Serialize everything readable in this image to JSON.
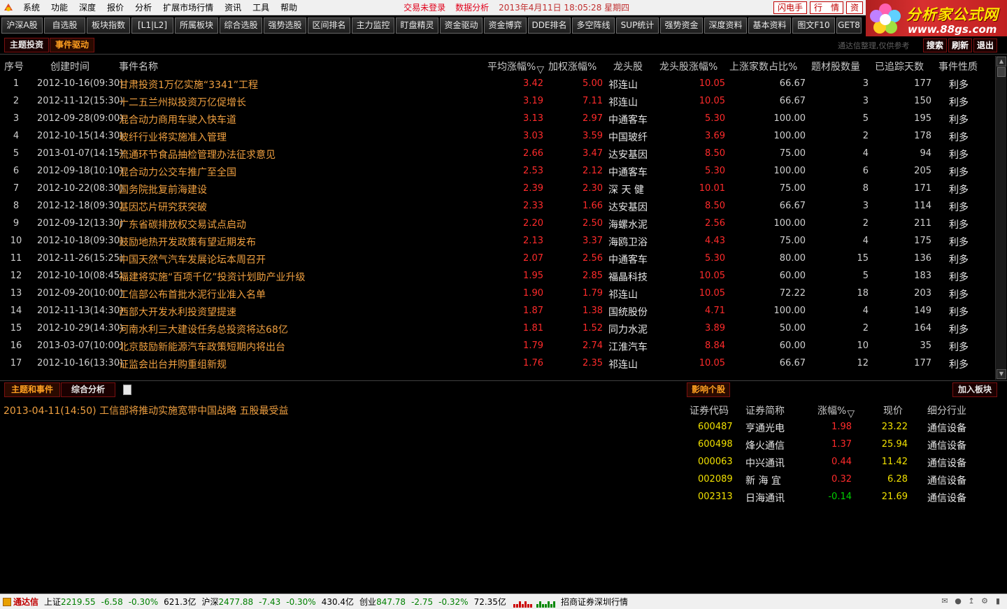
{
  "menu": {
    "items": [
      "系统",
      "功能",
      "深度",
      "报价",
      "分析",
      "扩展市场行情",
      "资讯",
      "工具",
      "帮助"
    ],
    "status_login": "交易未登录",
    "status_analysis": "数据分析",
    "datetime": "2013年4月11日  18:05:28  星期四",
    "btn_flash": "闪电手",
    "btn_quote": "行　情",
    "btn_info": "资"
  },
  "brand": {
    "title": "分析家公式网",
    "url": "www.88gs.com"
  },
  "toolbar": {
    "buttons": [
      "沪深A股",
      "自选股",
      "板块指数",
      "[L1|L2]",
      "所属板块",
      "综合选股",
      "强势选股",
      "区间排名",
      "主力监控",
      "盯盘精灵",
      "资金驱动",
      "资金博弈",
      "DDE排名",
      "多空阵线",
      "SUP统计",
      "强势资金",
      "深度资料",
      "基本资料",
      "图文F10",
      "GET8"
    ]
  },
  "subheader": {
    "tab_theme": "主题投资",
    "tab_event": "事件驱动",
    "hint": "通达信整理,仅供参考",
    "btn_search": "搜索",
    "btn_refresh": "刷新",
    "btn_exit": "退出"
  },
  "table": {
    "headers": {
      "idx": "序号",
      "time": "创建时间",
      "name": "事件名称",
      "avg": "平均涨幅%",
      "wavg": "加权涨幅%",
      "lead": "龙头股",
      "leadpct": "龙头股涨幅%",
      "up": "上涨家数占比%",
      "cnt": "题材股数量",
      "days": "已追踪天数",
      "type": "事件性质"
    },
    "rows": [
      {
        "idx": "1",
        "time": "2012-10-16(09:30)",
        "name": "甘肃投资1万亿实施“3341”工程",
        "avg": "3.42",
        "wavg": "5.00",
        "lead": "祁连山",
        "leadpct": "10.05",
        "up": "66.67",
        "cnt": "3",
        "days": "177",
        "type": "利多"
      },
      {
        "idx": "2",
        "time": "2012-11-12(15:30)",
        "name": "十二五兰州拟投资万亿促增长",
        "avg": "3.19",
        "wavg": "7.11",
        "lead": "祁连山",
        "leadpct": "10.05",
        "up": "66.67",
        "cnt": "3",
        "days": "150",
        "type": "利多"
      },
      {
        "idx": "3",
        "time": "2012-09-28(09:00)",
        "name": "混合动力商用车驶入快车道",
        "avg": "3.13",
        "wavg": "2.97",
        "lead": "中通客车",
        "leadpct": "5.30",
        "up": "100.00",
        "cnt": "5",
        "days": "195",
        "type": "利多"
      },
      {
        "idx": "4",
        "time": "2012-10-15(14:30)",
        "name": "玻纤行业将实施准入管理",
        "avg": "3.03",
        "wavg": "3.59",
        "lead": "中国玻纤",
        "leadpct": "3.69",
        "up": "100.00",
        "cnt": "2",
        "days": "178",
        "type": "利多"
      },
      {
        "idx": "5",
        "time": "2013-01-07(14:15)",
        "name": "流通环节食品抽检管理办法征求意见",
        "avg": "2.66",
        "wavg": "3.47",
        "lead": "达安基因",
        "leadpct": "8.50",
        "up": "75.00",
        "cnt": "4",
        "days": "94",
        "type": "利多"
      },
      {
        "idx": "6",
        "time": "2012-09-18(10:10)",
        "name": "混合动力公交车推广至全国",
        "avg": "2.53",
        "wavg": "2.12",
        "lead": "中通客车",
        "leadpct": "5.30",
        "up": "100.00",
        "cnt": "6",
        "days": "205",
        "type": "利多"
      },
      {
        "idx": "7",
        "time": "2012-10-22(08:30)",
        "name": "国务院批复前海建设",
        "avg": "2.39",
        "wavg": "2.30",
        "lead": "深 天 健",
        "leadpct": "10.01",
        "up": "75.00",
        "cnt": "8",
        "days": "171",
        "type": "利多"
      },
      {
        "idx": "8",
        "time": "2012-12-18(09:30)",
        "name": "基因芯片研究获突破",
        "avg": "2.33",
        "wavg": "1.66",
        "lead": "达安基因",
        "leadpct": "8.50",
        "up": "66.67",
        "cnt": "3",
        "days": "114",
        "type": "利多"
      },
      {
        "idx": "9",
        "time": "2012-09-12(13:30)",
        "name": "广东省碳排放权交易试点启动",
        "avg": "2.20",
        "wavg": "2.50",
        "lead": "海螺水泥",
        "leadpct": "2.56",
        "up": "100.00",
        "cnt": "2",
        "days": "211",
        "type": "利多"
      },
      {
        "idx": "10",
        "time": "2012-10-18(09:30)",
        "name": "鼓励地热开发政策有望近期发布",
        "avg": "2.13",
        "wavg": "3.37",
        "lead": "海鸥卫浴",
        "leadpct": "4.43",
        "up": "75.00",
        "cnt": "4",
        "days": "175",
        "type": "利多"
      },
      {
        "idx": "11",
        "time": "2012-11-26(15:25)",
        "name": "中国天然气汽车发展论坛本周召开",
        "avg": "2.07",
        "wavg": "2.56",
        "lead": "中通客车",
        "leadpct": "5.30",
        "up": "80.00",
        "cnt": "15",
        "days": "136",
        "type": "利多"
      },
      {
        "idx": "12",
        "time": "2012-10-10(08:45)",
        "name": "福建将实施“百项千亿”投资计划助产业升级",
        "avg": "1.95",
        "wavg": "2.85",
        "lead": "福晶科技",
        "leadpct": "10.05",
        "up": "60.00",
        "cnt": "5",
        "days": "183",
        "type": "利多"
      },
      {
        "idx": "13",
        "time": "2012-09-20(10:00)",
        "name": "工信部公布首批水泥行业准入名单",
        "avg": "1.90",
        "wavg": "1.79",
        "lead": "祁连山",
        "leadpct": "10.05",
        "up": "72.22",
        "cnt": "18",
        "days": "203",
        "type": "利多"
      },
      {
        "idx": "14",
        "time": "2012-11-13(14:30)",
        "name": "西部大开发水利投资望提速",
        "avg": "1.87",
        "wavg": "1.38",
        "lead": "国统股份",
        "leadpct": "4.71",
        "up": "100.00",
        "cnt": "4",
        "days": "149",
        "type": "利多"
      },
      {
        "idx": "15",
        "time": "2012-10-29(14:30)",
        "name": "河南水利三大建设任务总投资将达68亿",
        "avg": "1.81",
        "wavg": "1.52",
        "lead": "同力水泥",
        "leadpct": "3.89",
        "up": "50.00",
        "cnt": "2",
        "days": "164",
        "type": "利多"
      },
      {
        "idx": "16",
        "time": "2013-03-07(10:00)",
        "name": "北京鼓励新能源汽车政策短期内将出台",
        "avg": "1.79",
        "wavg": "2.74",
        "lead": "江淮汽车",
        "leadpct": "8.84",
        "up": "60.00",
        "cnt": "10",
        "days": "35",
        "type": "利多"
      },
      {
        "idx": "17",
        "time": "2012-10-16(13:30)",
        "name": "证监会出台并购重组新规",
        "avg": "1.76",
        "wavg": "2.35",
        "lead": "祁连山",
        "leadpct": "10.05",
        "up": "66.67",
        "cnt": "12",
        "days": "177",
        "type": "利多"
      }
    ]
  },
  "bottom": {
    "tab_theme_event": "主题和事件",
    "tab_analysis": "综合分析",
    "tab_affect": "影响个股",
    "btn_add": "加入板块",
    "news_time": "2013-04-11(14:50)",
    "news_text": "工信部将推动实施宽带中国战略 五股最受益",
    "stock_headers": {
      "code": "证券代码",
      "name": "证券简称",
      "chg": "涨幅%",
      "price": "现价",
      "ind": "细分行业"
    },
    "stocks": [
      {
        "code": "600487",
        "name": "亨通光电",
        "chg": "1.98",
        "price": "23.22",
        "ind": "通信设备",
        "dir": "up"
      },
      {
        "code": "600498",
        "name": "烽火通信",
        "chg": "1.37",
        "price": "25.94",
        "ind": "通信设备",
        "dir": "up"
      },
      {
        "code": "000063",
        "name": "中兴通讯",
        "chg": "0.44",
        "price": "11.42",
        "ind": "通信设备",
        "dir": "up"
      },
      {
        "code": "002089",
        "name": "新 海 宜",
        "chg": "0.32",
        "price": "6.28",
        "ind": "通信设备",
        "dir": "up"
      },
      {
        "code": "002313",
        "name": "日海通讯",
        "chg": "-0.14",
        "price": "21.69",
        "ind": "通信设备",
        "dir": "down"
      }
    ]
  },
  "statusbar": {
    "app": "通达信",
    "sh_label": "上证",
    "sh_value": "2219.55",
    "sh_chg": "-6.58",
    "sh_pct": "-0.30%",
    "sh_vol": "621.3亿",
    "hs_label": "沪深",
    "hs_value": "2477.88",
    "hs_chg": "-7.43",
    "hs_pct": "-0.30%",
    "hs_vol": "430.4亿",
    "cy_label": "创业",
    "cy_value": "847.78",
    "cy_chg": "-2.75",
    "cy_pct": "-0.32%",
    "cy_vol": "72.35亿",
    "broker": "招商证券深圳行情"
  },
  "colors": {
    "up": "#ff2b2b",
    "down": "#00d000",
    "accent": "#f0a040",
    "border": "#7a1010"
  }
}
